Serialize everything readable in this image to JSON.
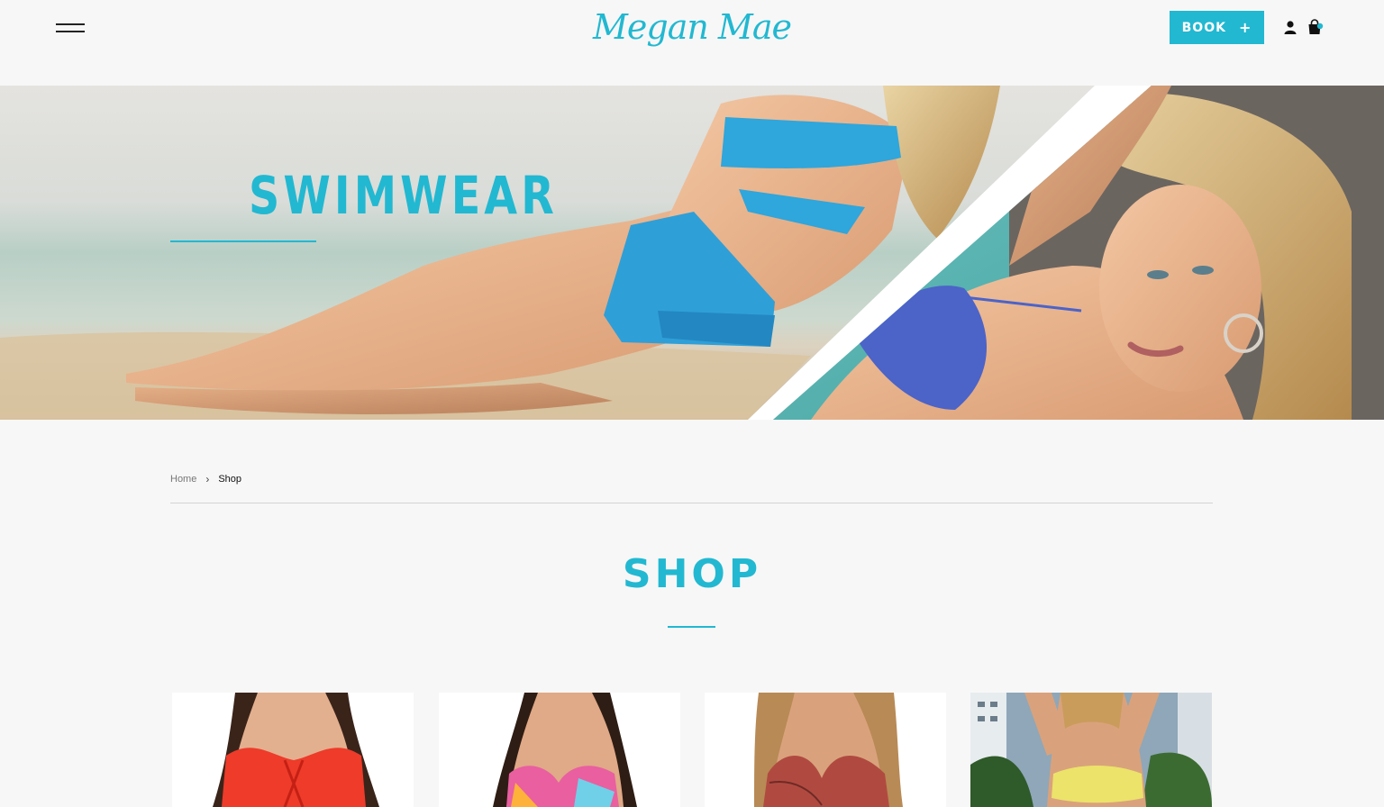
{
  "header": {
    "logo_text": "Megan Mae",
    "book_label": "BOOK",
    "book_icon": "plus-icon",
    "user_icon": "user-icon",
    "cart_icon": "shopping-bag-icon",
    "menu_icon": "hamburger-menu-icon"
  },
  "hero": {
    "title": "SWIMWEAR"
  },
  "breadcrumb": {
    "home": "Home",
    "separator_icon": "chevron-right-icon",
    "current": "Shop"
  },
  "shop": {
    "title": "SHOP"
  },
  "products": [
    {
      "swimsuit_color": "#ee3b2a"
    },
    {
      "swimsuit_color": "#e95fa0"
    },
    {
      "swimsuit_color": "#b04a40"
    },
    {
      "swimsuit_color": "#ece36a"
    }
  ],
  "colors": {
    "accent": "#22b8d1",
    "background": "#f7f7f7"
  }
}
